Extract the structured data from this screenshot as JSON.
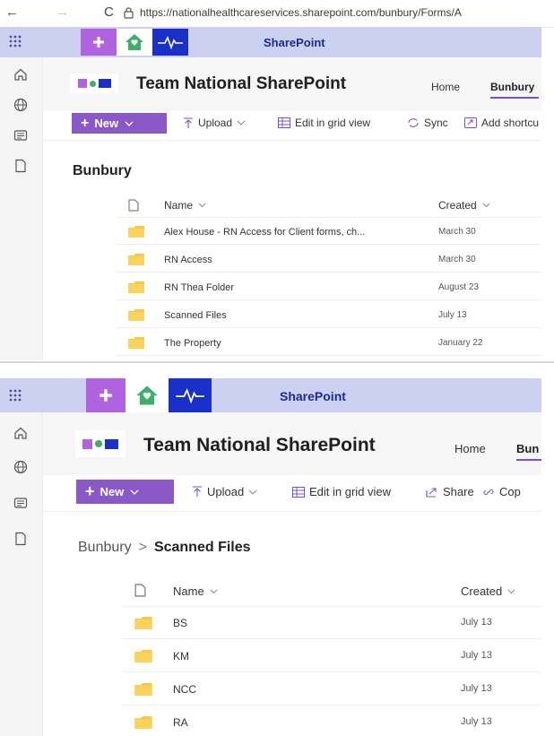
{
  "browser": {
    "back": "←",
    "forward": "→",
    "reload": "C",
    "url": "https://nationalhealthcareservices.sharepoint.com/bunbury/Forms/A"
  },
  "top": {
    "suite_label": "SharePoint",
    "site_name": "Team National SharePoint",
    "nav": {
      "home": "Home",
      "current": "Bunbury"
    },
    "commands": {
      "new": "New",
      "upload": "Upload",
      "grid": "Edit in grid view",
      "sync": "Sync",
      "shortcut": "Add shortcu"
    },
    "heading": "Bunbury",
    "columns": {
      "name": "Name",
      "created": "Created"
    },
    "rows": [
      {
        "name": "Alex House - RN Access for Client forms, ch...",
        "created": "March 30"
      },
      {
        "name": "RN Access",
        "created": "March 30"
      },
      {
        "name": "RN Thea Folder",
        "created": "August 23"
      },
      {
        "name": "Scanned Files",
        "created": "July 13"
      },
      {
        "name": "The Property",
        "created": "January 22"
      }
    ]
  },
  "bottom": {
    "suite_label": "SharePoint",
    "site_name": "Team National SharePoint",
    "nav": {
      "home": "Home",
      "current": "Bun"
    },
    "commands": {
      "new": "New",
      "upload": "Upload",
      "grid": "Edit in grid view",
      "share": "Share",
      "copy": "Cop"
    },
    "breadcrumb": {
      "parent": "Bunbury",
      "sep": ">",
      "current": "Scanned Files"
    },
    "columns": {
      "name": "Name",
      "created": "Created"
    },
    "rows": [
      {
        "name": "BS",
        "created": "July 13"
      },
      {
        "name": "KM",
        "created": "July 13"
      },
      {
        "name": "NCC",
        "created": "July 13"
      },
      {
        "name": "RA",
        "created": "July 13"
      }
    ]
  },
  "colors": {
    "suite": "#ccd1f1",
    "new_button": "#8a59c7",
    "folder": "#f7c948",
    "brand_blue": "#1b2fc9"
  }
}
